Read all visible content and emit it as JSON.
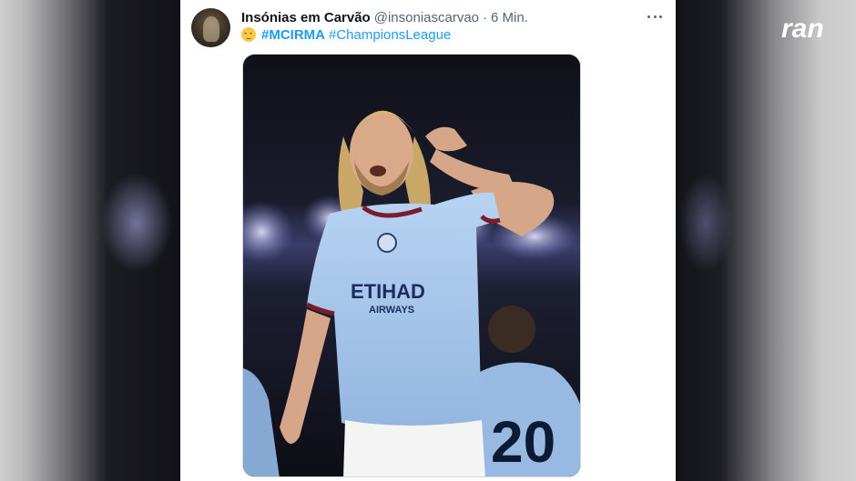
{
  "tweet": {
    "author_name": "Insónias em Carvão",
    "author_handle": "@insoniascarvao",
    "separator": "·",
    "time": "6 Min.",
    "hashtags": [
      "#MCIRMA",
      "#ChampionsLeague"
    ]
  },
  "photo": {
    "jersey_sponsor_line1": "ETIHAD",
    "jersey_sponsor_line2": "AIRWAYS",
    "back_number": "20"
  },
  "overlay": {
    "logo_text": "ran"
  },
  "icons": {
    "more": "more-horizontal-icon",
    "emoji": "relieved-face-icon"
  },
  "colors": {
    "hashtag": "#1d9bf0",
    "name": "#0f1419",
    "meta": "#536471",
    "jersey": "#a9c8ee"
  }
}
